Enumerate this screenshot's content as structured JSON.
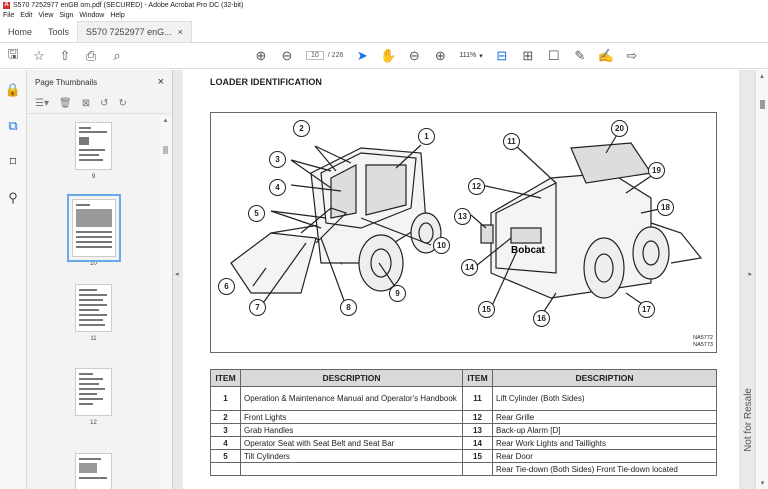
{
  "window": {
    "title": "S570 7252977 enGB om.pdf (SECURED) - Adobe Acrobat Pro DC (32-bit)",
    "app_icon": "A"
  },
  "menu": [
    "File",
    "Edit",
    "View",
    "Sign",
    "Window",
    "Help"
  ],
  "tabs": {
    "home": "Home",
    "tools": "Tools",
    "doc": "S570 7252977 enG...",
    "close": "×"
  },
  "toolbar": {
    "page_current": "10",
    "page_total": "/ 226",
    "zoom": "111%"
  },
  "thumbnails": {
    "title": "Page Thumbnails",
    "close": "×",
    "pages": [
      "9",
      "10",
      "11",
      "12"
    ],
    "selected": "10"
  },
  "document": {
    "heading": "LOADER IDENTIFICATION",
    "figure_code": [
      "NA5772",
      "NA5773"
    ],
    "callouts": [
      "1",
      "2",
      "3",
      "4",
      "5",
      "6",
      "7",
      "8",
      "9",
      "10",
      "11",
      "12",
      "13",
      "14",
      "15",
      "16",
      "17",
      "18",
      "19",
      "20"
    ],
    "table": {
      "headers": [
        "ITEM",
        "DESCRIPTION",
        "ITEM",
        "DESCRIPTION"
      ],
      "rows": [
        [
          "1",
          "Operation & Maintenance Manual and Operator's Handbook",
          "11",
          "Lift Cylinder (Both Sides)"
        ],
        [
          "2",
          "Front Lights",
          "12",
          "Rear Grille"
        ],
        [
          "3",
          "Grab Handles",
          "13",
          "Back-up Alarm [D]"
        ],
        [
          "4",
          "Operator Seat with Seat Belt and Seat Bar",
          "14",
          "Rear Work Lights and Taillights"
        ],
        [
          "5",
          "Tilt Cylinders",
          "15",
          "Rear Door"
        ],
        [
          "",
          "",
          "",
          "Rear Tie-down (Both Sides) Front Tie-down located"
        ]
      ]
    },
    "watermark": "Not for Resale"
  },
  "colors": {
    "accent": "#1473e6",
    "table_header": "#d9d9d9"
  }
}
